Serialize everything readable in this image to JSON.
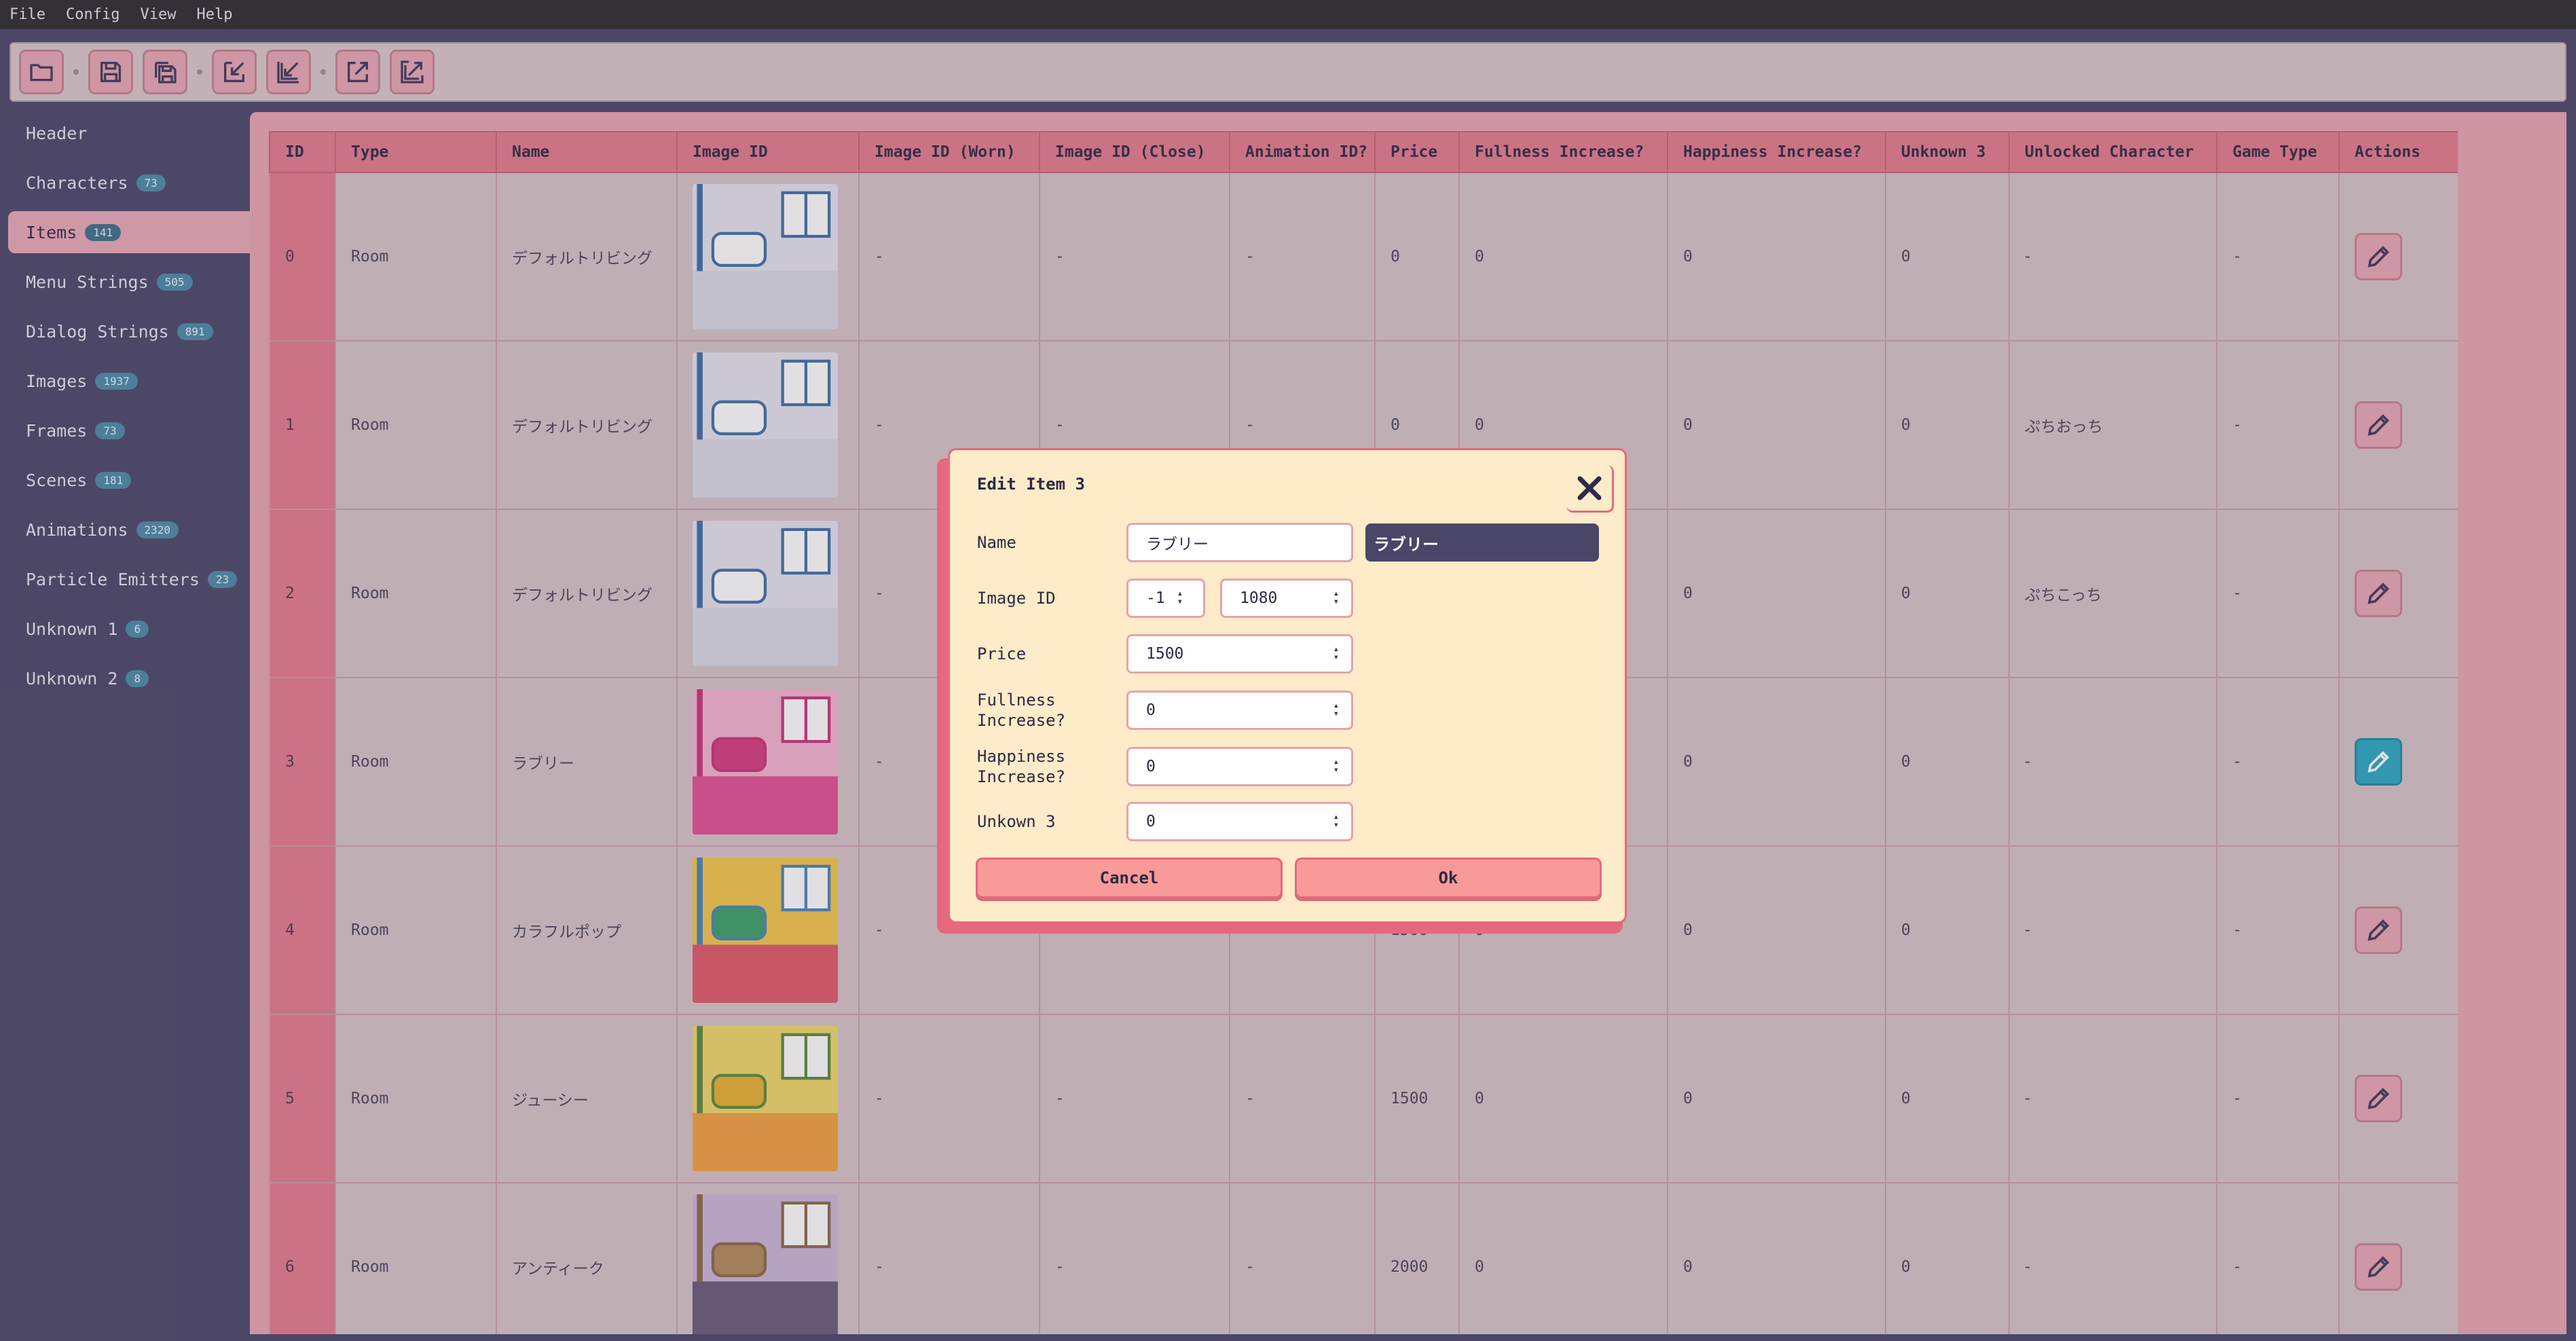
{
  "menu": [
    "File",
    "Config",
    "View",
    "Help"
  ],
  "sidebar": [
    {
      "label": "Header",
      "badge": ""
    },
    {
      "label": "Characters",
      "badge": "73"
    },
    {
      "label": "Items",
      "badge": "141",
      "active": true
    },
    {
      "label": "Menu Strings",
      "badge": "505"
    },
    {
      "label": "Dialog Strings",
      "badge": "891"
    },
    {
      "label": "Images",
      "badge": "1937"
    },
    {
      "label": "Frames",
      "badge": "73"
    },
    {
      "label": "Scenes",
      "badge": "181"
    },
    {
      "label": "Animations",
      "badge": "2320"
    },
    {
      "label": "Particle Emitters",
      "badge": "23"
    },
    {
      "label": "Unknown 1",
      "badge": "6"
    },
    {
      "label": "Unknown 2",
      "badge": "8"
    }
  ],
  "table": {
    "headers": [
      "ID",
      "Type",
      "Name",
      "Image ID",
      "Image ID (Worn)",
      "Image ID (Close)",
      "Animation ID?",
      "Price",
      "Fullness Increase?",
      "Happiness Increase?",
      "Unknown 3",
      "Unlocked Character",
      "Game Type",
      "Actions"
    ],
    "rows": [
      {
        "id": "0",
        "type": "Room",
        "name": "デフォルトリビング",
        "worn": "-",
        "close": "-",
        "anim": "-",
        "price": "0",
        "full": "0",
        "happy": "0",
        "unk3": "0",
        "char": "-",
        "game": "-",
        "thumb": "default"
      },
      {
        "id": "1",
        "type": "Room",
        "name": "デフォルトリビング",
        "worn": "-",
        "close": "-",
        "anim": "-",
        "price": "0",
        "full": "0",
        "happy": "0",
        "unk3": "0",
        "char": "ぷちおっち",
        "game": "-",
        "thumb": "default"
      },
      {
        "id": "2",
        "type": "Room",
        "name": "デフォルトリビング",
        "worn": "-",
        "close": "",
        "anim": "",
        "price": "",
        "full": "",
        "happy": "0",
        "unk3": "0",
        "char": "ぷちこっち",
        "game": "-",
        "thumb": "default"
      },
      {
        "id": "3",
        "type": "Room",
        "name": "ラブリー",
        "worn": "-",
        "close": "",
        "anim": "",
        "price": "",
        "full": "",
        "happy": "0",
        "unk3": "0",
        "char": "-",
        "game": "-",
        "thumb": "lovely",
        "active": true
      },
      {
        "id": "4",
        "type": "Room",
        "name": "カラフルポップ",
        "worn": "-",
        "close": "-",
        "anim": "-",
        "price": "1500",
        "full": "0",
        "happy": "0",
        "unk3": "0",
        "char": "-",
        "game": "-",
        "thumb": "colorful"
      },
      {
        "id": "5",
        "type": "Room",
        "name": "ジューシー",
        "worn": "-",
        "close": "-",
        "anim": "-",
        "price": "1500",
        "full": "0",
        "happy": "0",
        "unk3": "0",
        "char": "-",
        "game": "-",
        "thumb": "juicy"
      },
      {
        "id": "6",
        "type": "Room",
        "name": "アンティーク",
        "worn": "-",
        "close": "-",
        "anim": "-",
        "price": "2000",
        "full": "0",
        "happy": "0",
        "unk3": "0",
        "char": "-",
        "game": "-",
        "thumb": "antique"
      }
    ]
  },
  "dialog": {
    "title": "Edit Item 3",
    "name_label": "Name",
    "name_value": "ラブリー",
    "name_preview": "ラブリー",
    "image_id_label": "Image ID",
    "image_id_a": "-1",
    "image_id_b": "1080",
    "price_label": "Price",
    "price_value": "1500",
    "fullness_label": "Fullness Increase?",
    "fullness_value": "0",
    "happiness_label": "Happiness Increase?",
    "happiness_value": "0",
    "unknown3_label": "Unkown 3",
    "unknown3_value": "0",
    "cancel_label": "Cancel",
    "ok_label": "Ok"
  },
  "icons": [
    "folder-icon",
    "save-icon",
    "save-all-icon",
    "import-icon",
    "import-all-icon",
    "export-icon",
    "export-all-icon",
    "pencil-icon",
    "close-icon"
  ],
  "colors": {
    "accent": "#e6687d",
    "active_edit": "#2aa8c4",
    "badge": "#4b8aa8",
    "sidebar_bg": "#4a4668"
  }
}
